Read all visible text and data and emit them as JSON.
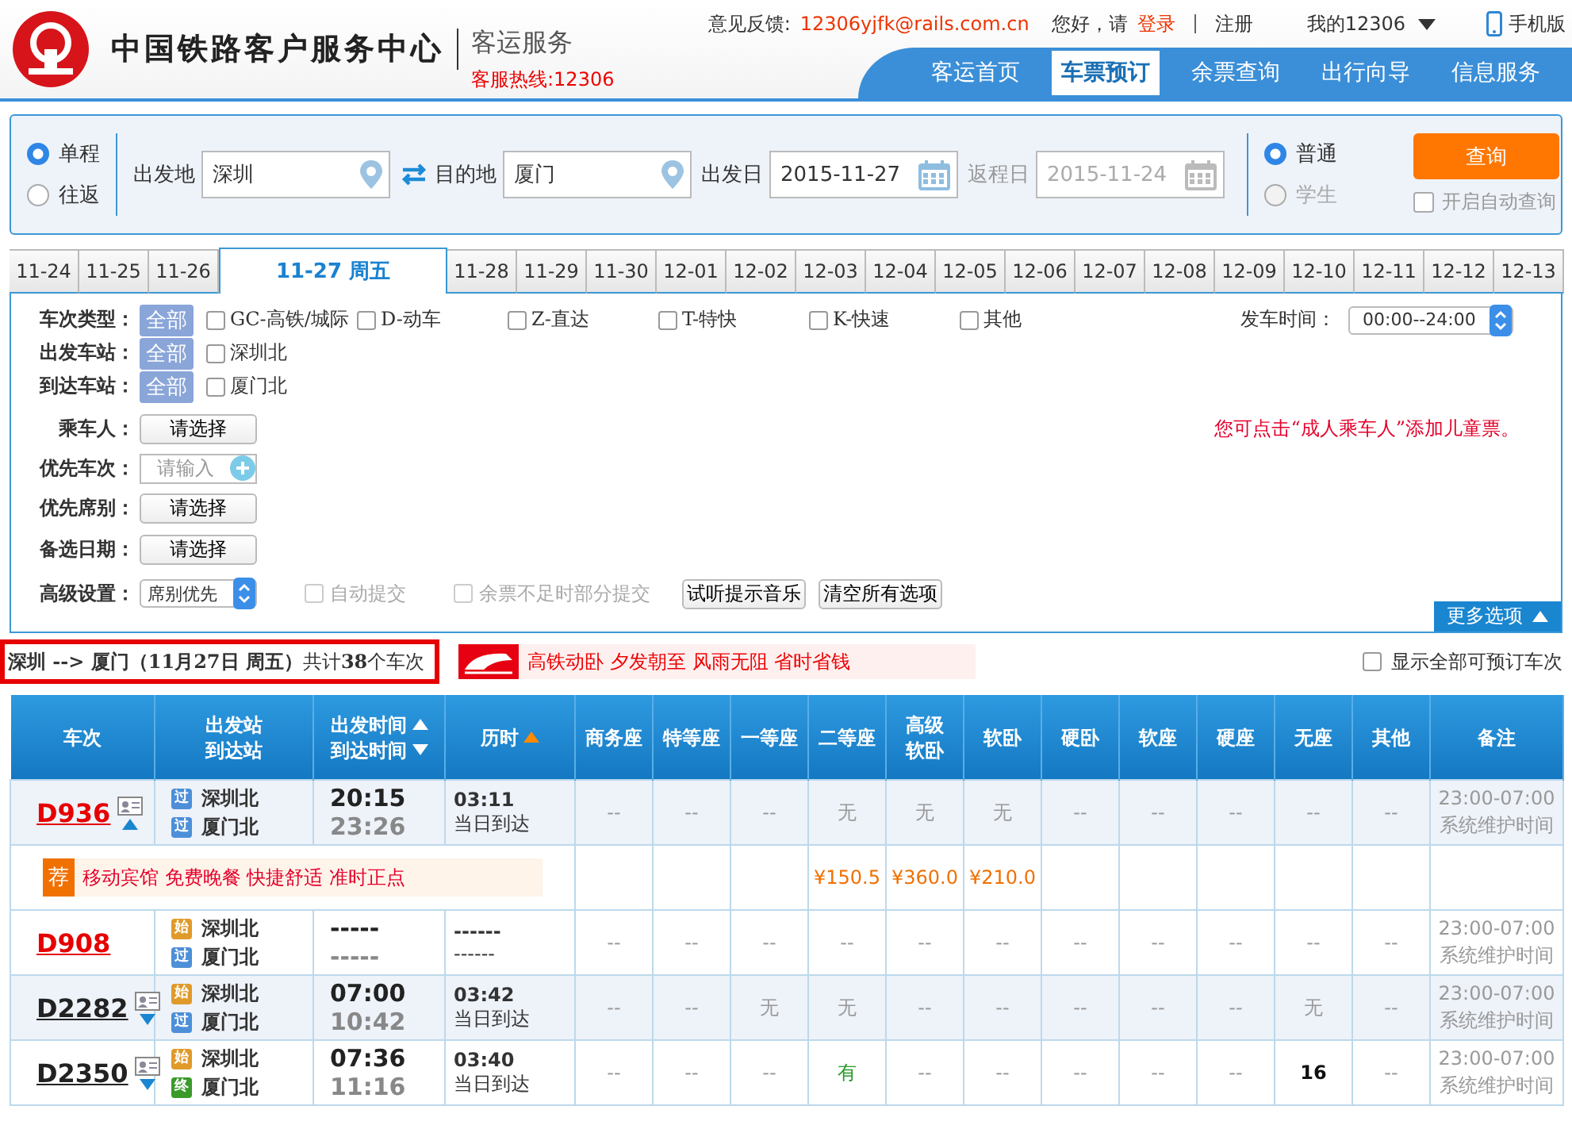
{
  "header": {
    "logo_title": "中国铁路客户服务中心",
    "subtitle": "客运服务",
    "hotline": "客服热线:12306",
    "feedback_label": "意见反馈:",
    "feedback_email": "12306yjfk@rails.com.cn",
    "greeting": "您好，请",
    "login": "登录",
    "register": "注册",
    "my_account": "我的12306",
    "mobile": "手机版",
    "nav": [
      {
        "label": "客运首页",
        "selected": false
      },
      {
        "label": "车票预订",
        "selected": true
      },
      {
        "label": "余票查询",
        "selected": false
      },
      {
        "label": "出行向导",
        "selected": false
      },
      {
        "label": "信息服务",
        "selected": false
      }
    ]
  },
  "search": {
    "trip_types": [
      {
        "label": "单程",
        "selected": true
      },
      {
        "label": "往返",
        "selected": false
      }
    ],
    "from_label": "出发地",
    "from_value": "深圳",
    "to_label": "目的地",
    "to_value": "厦门",
    "date_label": "出发日",
    "date_value": "2015-11-27",
    "return_label": "返程日",
    "return_value": "2015-11-24",
    "return_disabled": true,
    "passenger_types": [
      {
        "label": "普通",
        "selected": true,
        "disabled": false
      },
      {
        "label": "学生",
        "selected": false,
        "disabled": true
      }
    ],
    "query_button": "查询",
    "auto_query": {
      "label": "开启自动查询",
      "checked": false
    }
  },
  "date_tabs": [
    {
      "label": "11-24",
      "selected": false
    },
    {
      "label": "11-25",
      "selected": false
    },
    {
      "label": "11-26",
      "selected": false
    },
    {
      "label": "11-27 周五",
      "selected": true
    },
    {
      "label": "11-28",
      "selected": false
    },
    {
      "label": "11-29",
      "selected": false
    },
    {
      "label": "11-30",
      "selected": false
    },
    {
      "label": "12-01",
      "selected": false
    },
    {
      "label": "12-02",
      "selected": false
    },
    {
      "label": "12-03",
      "selected": false
    },
    {
      "label": "12-04",
      "selected": false
    },
    {
      "label": "12-05",
      "selected": false
    },
    {
      "label": "12-06",
      "selected": false
    },
    {
      "label": "12-07",
      "selected": false
    },
    {
      "label": "12-08",
      "selected": false
    },
    {
      "label": "12-09",
      "selected": false
    },
    {
      "label": "12-10",
      "selected": false
    },
    {
      "label": "12-11",
      "selected": false
    },
    {
      "label": "12-12",
      "selected": false
    },
    {
      "label": "12-13",
      "selected": false
    }
  ],
  "filters": {
    "option_rows": [
      {
        "label": "车次类型：",
        "all": "全部",
        "options": [
          {
            "label": "GC-高铁/城际",
            "checked": false
          },
          {
            "label": "D-动车",
            "checked": false
          },
          {
            "label": "Z-直达",
            "checked": false
          },
          {
            "label": "T-特快",
            "checked": false
          },
          {
            "label": "K-快速",
            "checked": false
          },
          {
            "label": "其他",
            "checked": false
          }
        ]
      },
      {
        "label": "出发车站：",
        "all": "全部",
        "options": [
          {
            "label": "深圳北",
            "checked": false
          }
        ]
      },
      {
        "label": "到达车站：",
        "all": "全部",
        "options": [
          {
            "label": "厦门北",
            "checked": false
          }
        ]
      }
    ],
    "time_label": "发车时间：",
    "time_value": "00:00--24:00",
    "passenger": {
      "label": "乘车人：",
      "button": "请选择"
    },
    "child_notice": "您可点击“成人乘车人”添加儿童票。",
    "preferred_train": {
      "label": "优先车次：",
      "placeholder": "请输入"
    },
    "preferred_seat": {
      "label": "优先席别：",
      "button": "请选择"
    },
    "alt_date": {
      "label": "备选日期：",
      "button": "请选择"
    },
    "advanced": {
      "label": "高级设置：",
      "select": "席别优先",
      "checks": [
        {
          "label": "自动提交",
          "checked": false,
          "disabled": true
        },
        {
          "label": "余票不足时部分提交",
          "checked": false,
          "disabled": true
        }
      ],
      "buttons": [
        "试听提示音乐",
        "清空所有选项"
      ]
    },
    "more_button": "更多选项"
  },
  "result": {
    "summary": "**深圳 --> 厦门（11月27日  周五）**共计**38**个车次",
    "banner": "高铁动卧 夕发朝至 风雨无阻 省时省钱",
    "show_all": {
      "label": "显示全部可预订车次",
      "checked": false
    }
  },
  "table": {
    "columns": [
      {
        "lines": [
          "车次"
        ]
      },
      {
        "lines": [
          "出发站",
          "到达站"
        ]
      },
      {
        "lines": [
          "出发时间",
          "到达时间"
        ],
        "sortable": true,
        "sort_active": false
      },
      {
        "lines": [
          "历时"
        ],
        "sortable": true,
        "sort_active": true
      },
      {
        "lines": [
          "商务座"
        ]
      },
      {
        "lines": [
          "特等座"
        ]
      },
      {
        "lines": [
          "一等座"
        ]
      },
      {
        "lines": [
          "二等座"
        ]
      },
      {
        "lines": [
          "高级",
          "软卧"
        ]
      },
      {
        "lines": [
          "软卧"
        ]
      },
      {
        "lines": [
          "硬卧"
        ]
      },
      {
        "lines": [
          "软座"
        ]
      },
      {
        "lines": [
          "硬座"
        ]
      },
      {
        "lines": [
          "无座"
        ]
      },
      {
        "lines": [
          "其他"
        ]
      },
      {
        "lines": [
          "备注"
        ]
      }
    ],
    "rows": [
      {
        "train": "D936",
        "highlighted": true,
        "details": true,
        "expanded": true,
        "from": {
          "badge": "过",
          "kind": "pass",
          "station": "深圳北"
        },
        "to": {
          "badge": "过",
          "kind": "pass",
          "station": "厦门北"
        },
        "depart": "20:15",
        "arrive": "23:26",
        "duration": "03:11",
        "arrival_day": "当日到达",
        "seats": [
          {
            "v": "--",
            "kind": "na"
          },
          {
            "v": "--",
            "kind": "na"
          },
          {
            "v": "--",
            "kind": "na"
          },
          {
            "v": "无",
            "kind": "none",
            "price": "¥150.5"
          },
          {
            "v": "无",
            "kind": "none",
            "price": "¥360.0"
          },
          {
            "v": "无",
            "kind": "none",
            "price": "¥210.0"
          },
          {
            "v": "--",
            "kind": "na"
          },
          {
            "v": "--",
            "kind": "na"
          },
          {
            "v": "--",
            "kind": "na"
          },
          {
            "v": "--",
            "kind": "na"
          },
          {
            "v": "--",
            "kind": "na"
          }
        ],
        "note": "23:00-07:00系统维护时间",
        "promo": {
          "badge": "荐",
          "text": "移动宾馆 免费晚餐 快捷舒适 准时正点"
        }
      },
      {
        "train": "D908",
        "highlighted": true,
        "details": false,
        "from": {
          "badge": "始",
          "kind": "start",
          "station": "深圳北"
        },
        "to": {
          "badge": "过",
          "kind": "pass",
          "station": "厦门北"
        },
        "depart": "-----",
        "arrive": "-----",
        "duration": "------",
        "arrival_day": "------",
        "seats": [
          {
            "v": "--",
            "kind": "na"
          },
          {
            "v": "--",
            "kind": "na"
          },
          {
            "v": "--",
            "kind": "na"
          },
          {
            "v": "--",
            "kind": "na"
          },
          {
            "v": "--",
            "kind": "na"
          },
          {
            "v": "--",
            "kind": "na"
          },
          {
            "v": "--",
            "kind": "na"
          },
          {
            "v": "--",
            "kind": "na"
          },
          {
            "v": "--",
            "kind": "na"
          },
          {
            "v": "--",
            "kind": "na"
          },
          {
            "v": "--",
            "kind": "na"
          }
        ],
        "note": "23:00-07:00系统维护时间"
      },
      {
        "train": "D2282",
        "highlighted": false,
        "details": true,
        "expanded": false,
        "from": {
          "badge": "始",
          "kind": "start",
          "station": "深圳北"
        },
        "to": {
          "badge": "过",
          "kind": "pass",
          "station": "厦门北"
        },
        "depart": "07:00",
        "arrive": "10:42",
        "duration": "03:42",
        "arrival_day": "当日到达",
        "seats": [
          {
            "v": "--",
            "kind": "na"
          },
          {
            "v": "--",
            "kind": "na"
          },
          {
            "v": "无",
            "kind": "none"
          },
          {
            "v": "无",
            "kind": "none"
          },
          {
            "v": "--",
            "kind": "na"
          },
          {
            "v": "--",
            "kind": "na"
          },
          {
            "v": "--",
            "kind": "na"
          },
          {
            "v": "--",
            "kind": "na"
          },
          {
            "v": "--",
            "kind": "na"
          },
          {
            "v": "无",
            "kind": "none"
          },
          {
            "v": "--",
            "kind": "na"
          }
        ],
        "note": "23:00-07:00系统维护时间"
      },
      {
        "train": "D2350",
        "highlighted": false,
        "details": true,
        "expanded": false,
        "from": {
          "badge": "始",
          "kind": "start",
          "station": "深圳北"
        },
        "to": {
          "badge": "终",
          "kind": "end",
          "station": "厦门北"
        },
        "depart": "07:36",
        "arrive": "11:16",
        "duration": "03:40",
        "arrival_day": "当日到达",
        "seats": [
          {
            "v": "--",
            "kind": "na"
          },
          {
            "v": "--",
            "kind": "na"
          },
          {
            "v": "--",
            "kind": "na"
          },
          {
            "v": "有",
            "kind": "avail"
          },
          {
            "v": "--",
            "kind": "na"
          },
          {
            "v": "--",
            "kind": "na"
          },
          {
            "v": "--",
            "kind": "na"
          },
          {
            "v": "--",
            "kind": "na"
          },
          {
            "v": "--",
            "kind": "na"
          },
          {
            "v": "16",
            "kind": "count"
          },
          {
            "v": "--",
            "kind": "na"
          }
        ],
        "note": "23:00-07:00系统维护时间"
      }
    ]
  }
}
